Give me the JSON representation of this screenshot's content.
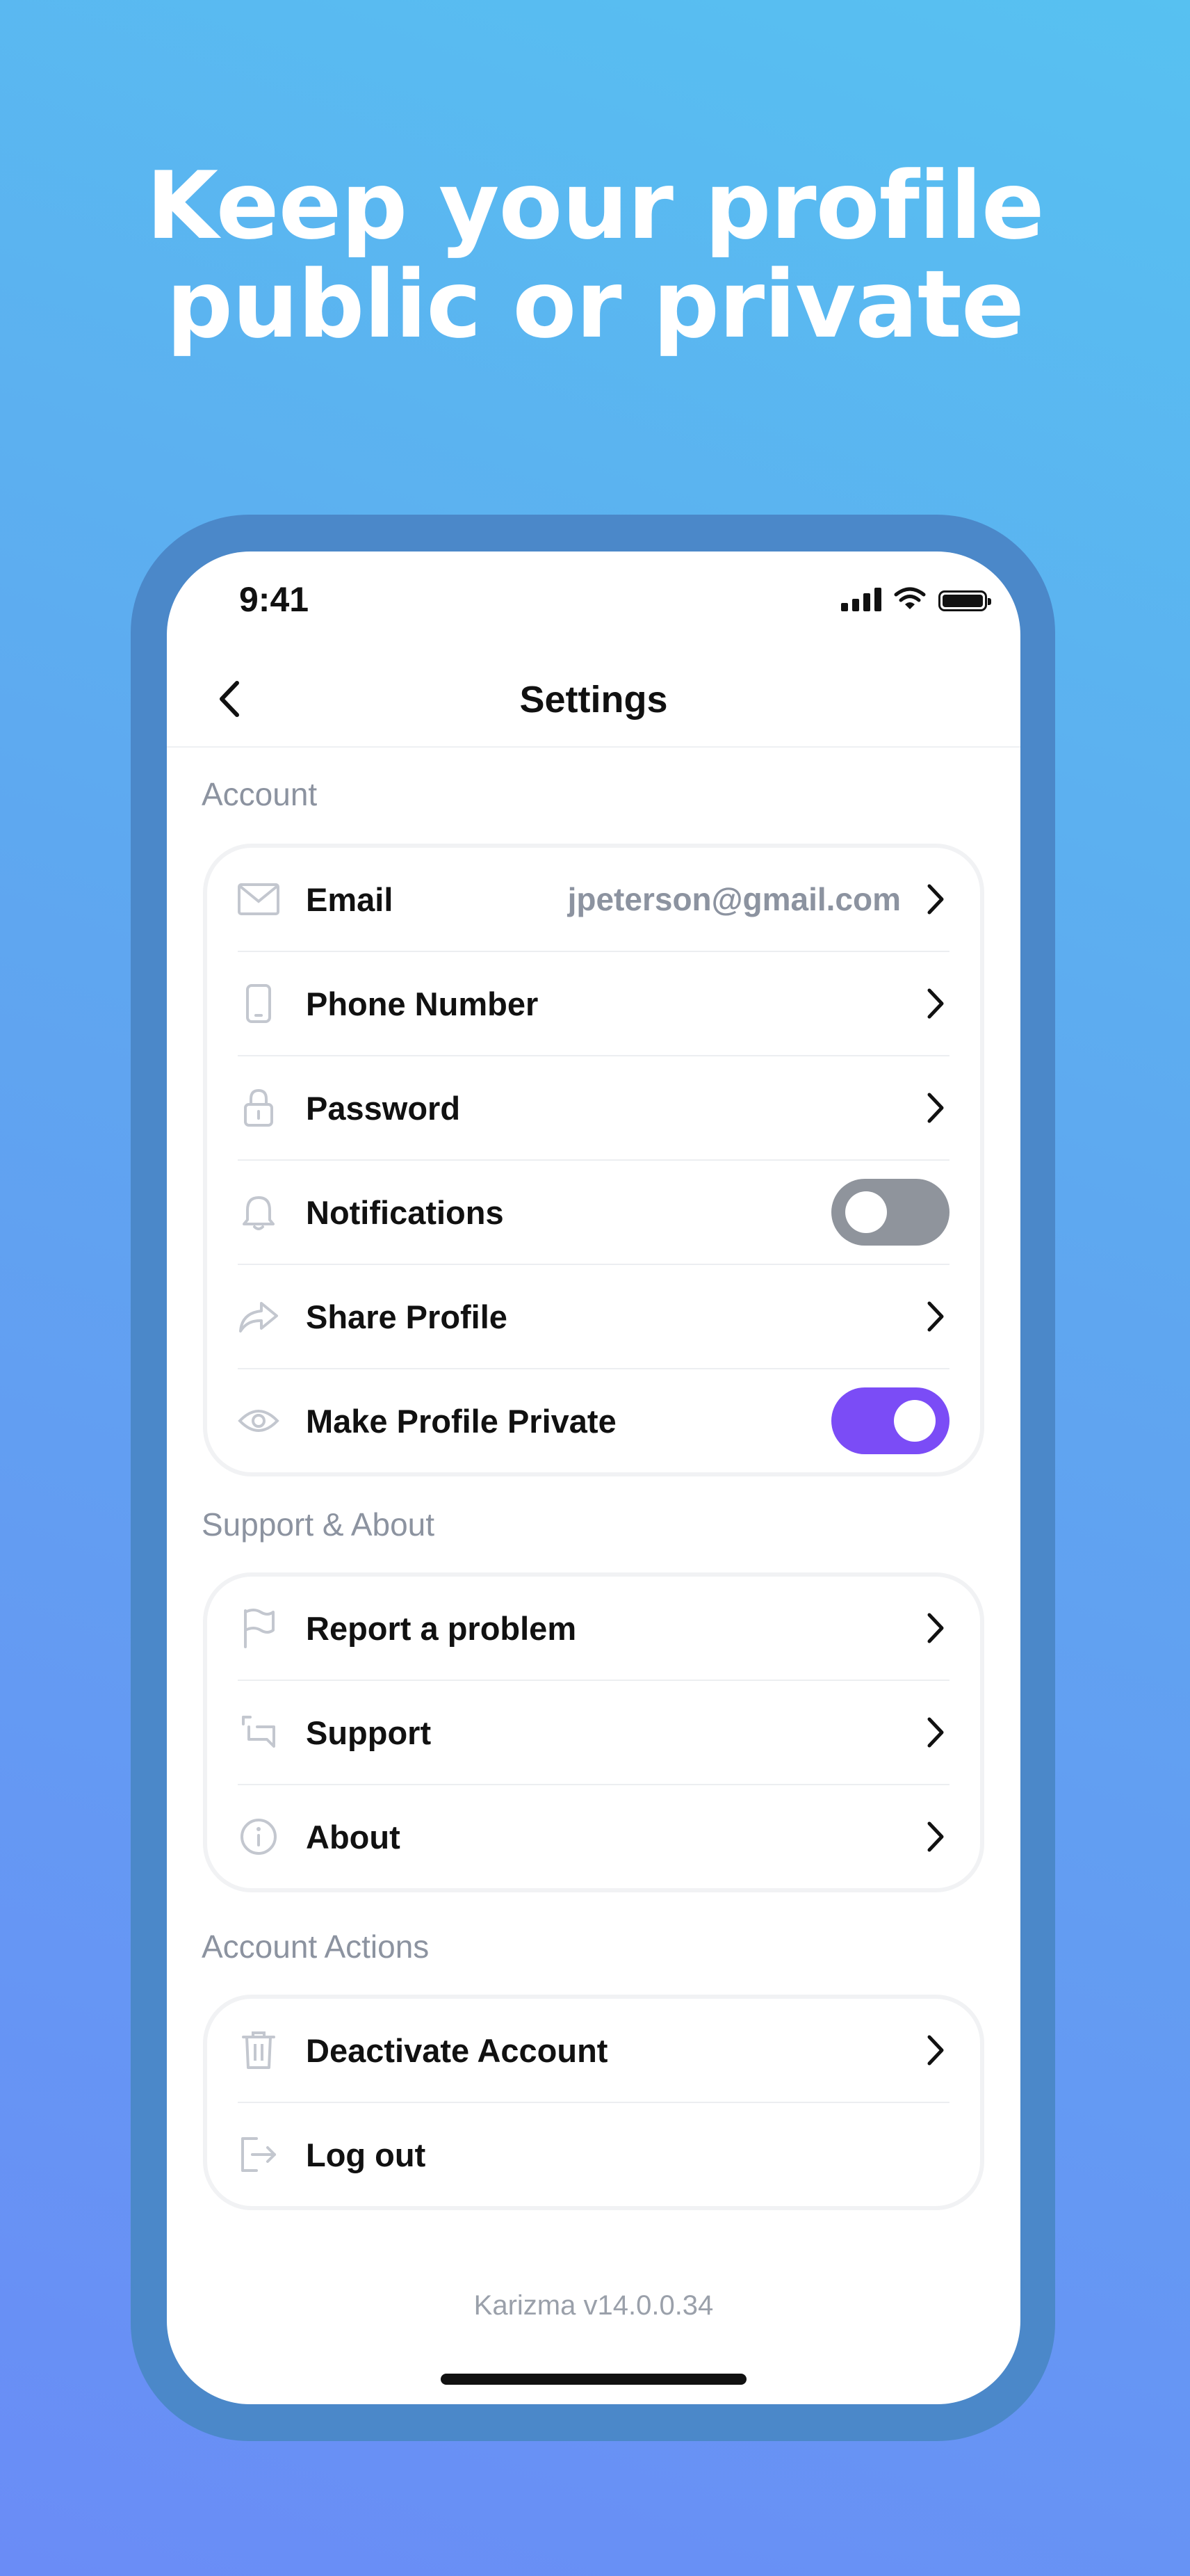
{
  "headline": {
    "line1": "Keep your profile",
    "line2": "public or private"
  },
  "status_bar": {
    "time": "9:41"
  },
  "nav": {
    "title": "Settings"
  },
  "sections": {
    "account": {
      "label": "Account",
      "items": [
        {
          "label": "Email",
          "value": "jpeterson@gmail.com",
          "icon": "mail-icon",
          "control": "chevron"
        },
        {
          "label": "Phone Number",
          "icon": "phone-icon",
          "control": "chevron"
        },
        {
          "label": "Password",
          "icon": "lock-icon",
          "control": "chevron"
        },
        {
          "label": "Notifications",
          "icon": "bell-icon",
          "control": "toggle",
          "on": false
        },
        {
          "label": "Share Profile",
          "icon": "share-icon",
          "control": "chevron"
        },
        {
          "label": "Make Profile Private",
          "icon": "eye-icon",
          "control": "toggle",
          "on": true
        }
      ]
    },
    "support": {
      "label": "Support & About",
      "items": [
        {
          "label": "Report a problem",
          "icon": "flag-icon",
          "control": "chevron"
        },
        {
          "label": "Support",
          "icon": "chat-icon",
          "control": "chevron"
        },
        {
          "label": "About",
          "icon": "info-icon",
          "control": "chevron"
        }
      ]
    },
    "actions": {
      "label": "Account Actions",
      "items": [
        {
          "label": "Deactivate Account",
          "icon": "trash-icon",
          "control": "chevron"
        },
        {
          "label": "Log out",
          "icon": "logout-icon",
          "control": "none"
        }
      ]
    }
  },
  "version": "Karizma v14.0.0.34",
  "colors": {
    "accent": "#7b4cf6",
    "toggle_off": "#8f949c",
    "muted_text": "#8c93a0"
  }
}
